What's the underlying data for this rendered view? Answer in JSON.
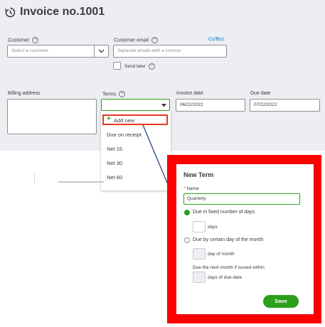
{
  "invoice": {
    "title": "Invoice no.1001"
  },
  "customer": {
    "label": "Customer",
    "placeholder": "Select a customer"
  },
  "customer_email": {
    "label": "Customer email",
    "placeholder": "Separate emails with a comma",
    "cc_bcc": "Cc/Bcc"
  },
  "send_later": {
    "label": "Send later",
    "checked": false
  },
  "billing_address": {
    "label": "Billing address"
  },
  "terms": {
    "label": "Terms",
    "value": "",
    "add_new": "Add new",
    "options": [
      "Due on receipt",
      "Net 15",
      "Net 30",
      "Net 60"
    ]
  },
  "invoice_date": {
    "label": "Invoice date",
    "value": "06/22/2022"
  },
  "due_date": {
    "label": "Due date",
    "value": "07/22/2022"
  },
  "new_term": {
    "title": "New Term",
    "required_mark": "*",
    "name_label": "Name",
    "name_value": "Quarterly",
    "option_fixed": {
      "label": "Due in fixed number of days",
      "selected": true,
      "unit": "days"
    },
    "option_day_of_month": {
      "label": "Due by certain day of the month",
      "selected": false,
      "unit": "day of month"
    },
    "option_next_month": {
      "label": "Due the next month if issued within",
      "unit": "days of due date"
    },
    "save": "Save"
  },
  "colors": {
    "accent_green": "#2ca01c",
    "highlight_red": "#ff0000",
    "link_blue": "#0077c5",
    "panel_bg": "#eceef1"
  }
}
